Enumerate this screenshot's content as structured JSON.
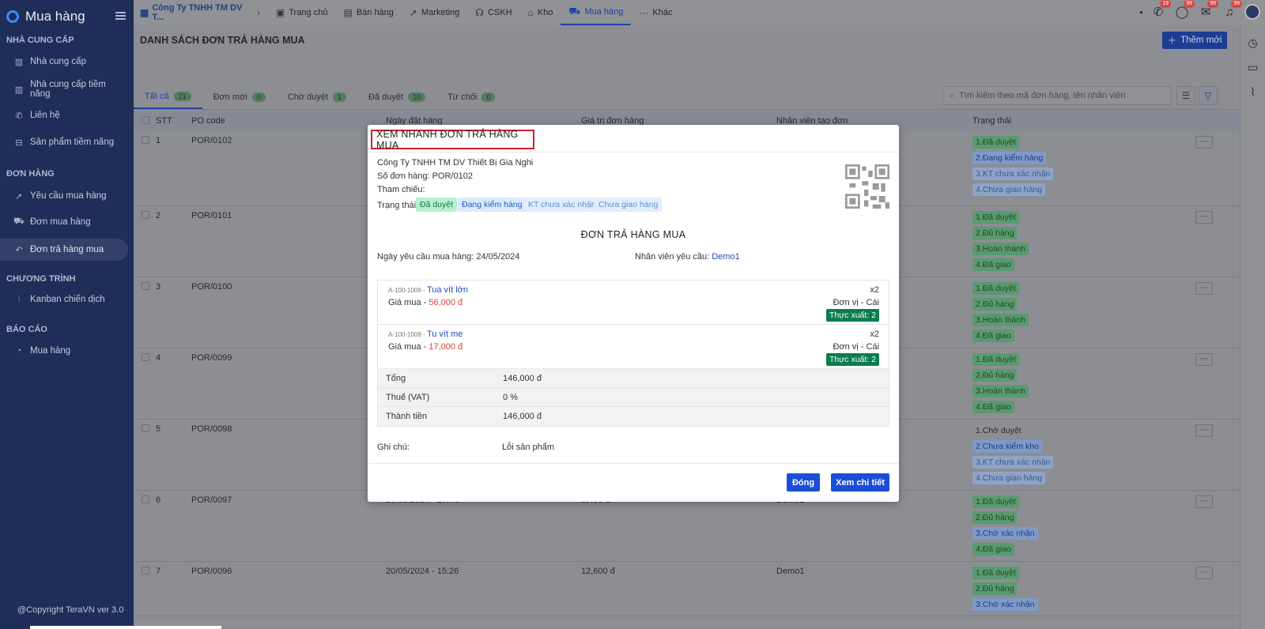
{
  "app": {
    "name": "Mua hàng",
    "copyright": "@Copyright TeraVN ver 3.0"
  },
  "sidebar": {
    "sections": [
      {
        "title": "NHÀ CUNG CẤP",
        "items": [
          {
            "label": "Nhà cung cấp",
            "icon": "building-icon"
          },
          {
            "label": "Nhà cung cấp tiềm năng",
            "icon": "building-icon"
          },
          {
            "label": "Liên hệ",
            "icon": "phone-icon"
          },
          {
            "label": "Sản phẩm tiềm năng",
            "icon": "box-icon"
          }
        ]
      },
      {
        "title": "ĐƠN HÀNG",
        "items": [
          {
            "label": "Yêu cầu mua hàng",
            "icon": "rocket-icon"
          },
          {
            "label": "Đơn mua hàng",
            "icon": "cart-icon"
          },
          {
            "label": "Đơn trả hàng mua",
            "icon": "return-icon",
            "active": true
          }
        ]
      },
      {
        "title": "CHƯƠNG TRÌNH",
        "items": [
          {
            "label": "Kanban chiến dịch",
            "icon": "kanban-icon"
          }
        ]
      },
      {
        "title": "BÁO CÁO",
        "items": [
          {
            "label": "Mua hàng",
            "icon": "pie-chart-icon"
          }
        ]
      }
    ]
  },
  "topbar": {
    "company": "Công Ty TNHH TM DV T...",
    "nav": [
      {
        "label": "Trang chủ",
        "icon": "home-icon"
      },
      {
        "label": "Bán hàng",
        "icon": "box-icon"
      },
      {
        "label": "Marketing",
        "icon": "rocket-icon"
      },
      {
        "label": "CSKH",
        "icon": "headset-icon"
      },
      {
        "label": "Kho",
        "icon": "warehouse-icon"
      },
      {
        "label": "Mua hàng",
        "icon": "cart-icon",
        "active": true
      },
      {
        "label": "Khác",
        "icon": "more-icon"
      }
    ],
    "badges": {
      "phone": "19",
      "chat": "99",
      "mail": "99",
      "bell": "99"
    }
  },
  "main": {
    "title": "DANH SÁCH ĐƠN TRẢ HÀNG MUA",
    "add_button": "Thêm mới",
    "search_placeholder": "Tìm kiếm theo mã đơn hàng, tên nhân viên",
    "tabs": [
      {
        "label": "Tất cả",
        "count": "21"
      },
      {
        "label": "Đơn mới",
        "count": "0"
      },
      {
        "label": "Chờ duyệt",
        "count": "1"
      },
      {
        "label": "Đã duyệt",
        "count": "10"
      },
      {
        "label": "Từ chối",
        "count": "0"
      }
    ],
    "columns": [
      "STT",
      "PO code",
      "Ngày đặt hàng",
      "Giá trị đơn hàng",
      "Nhân viên tạo đơn",
      "Trạng thái"
    ],
    "rows": [
      {
        "stt": "1",
        "code": "POR/0102",
        "date": "",
        "value": "",
        "staff": "",
        "status": [
          "1.Đã duyệt",
          "2.Đang kiểm hàng",
          "3.KT chưa xác nhận",
          "4.Chưa giao hàng"
        ]
      },
      {
        "stt": "2",
        "code": "POR/0101",
        "date": "",
        "value": "",
        "staff": "",
        "status": [
          "1.Đã duyệt",
          "2.Đủ hàng",
          "3.Hoàn thành",
          "4.Đã giao"
        ]
      },
      {
        "stt": "3",
        "code": "POR/0100",
        "date": "",
        "value": "",
        "staff": "",
        "status": [
          "1.Đã duyệt",
          "2.Đủ hàng",
          "3.Hoàn thành",
          "4.Đã giao"
        ]
      },
      {
        "stt": "4",
        "code": "POR/0099",
        "date": "",
        "value": "",
        "staff": "",
        "status": [
          "1.Đã duyệt",
          "2.Đủ hàng",
          "3.Hoàn thành",
          "4.Đã giao"
        ]
      },
      {
        "stt": "5",
        "code": "POR/0098",
        "date": "",
        "value": "",
        "staff": "",
        "status": [
          "1.Chờ duyệt",
          "2.Chưa kiểm kho",
          "3.KT chưa xác nhận",
          "4.Chưa giao hàng"
        ]
      },
      {
        "stt": "6",
        "code": "POR/0097",
        "date": "20/05/2024 - 17:40",
        "value": "8,400 đ",
        "staff": "Demo1",
        "status": [
          "1.Đã duyệt",
          "2.Đủ hàng",
          "3.Chờ xác nhận",
          "4.Đã giao"
        ]
      },
      {
        "stt": "7",
        "code": "POR/0096",
        "date": "20/05/2024 - 15:26",
        "value": "12,600 đ",
        "staff": "Demo1",
        "status": [
          "1.Đã duyệt",
          "2.Đủ hàng",
          "3.Chờ xác nhận"
        ]
      }
    ]
  },
  "modal": {
    "title": "XEM NHANH ĐƠN TRẢ HÀNG MUA",
    "company": "Công Ty TNHH TM DV Thiết Bị Gia Nghi",
    "order_no": "Số đơn hàng: POR/0102",
    "reference": "Tham chiếu:",
    "status_label": "Trạng thái:",
    "tags": [
      "Đã duyệt",
      "Đang kiểm hàng",
      "KT chưa xác nhận",
      "Chưa giao hàng"
    ],
    "heading": "ĐƠN TRẢ HÀNG MUA",
    "request_date": "Ngày yêu cầu mua hàng: 24/05/2024",
    "requester_label": "Nhân viên yêu cầu:",
    "requester": "Demo1",
    "items": [
      {
        "code": "A-100-1008 -",
        "name": "Tua vít lớn",
        "price_label": "Giá mua -",
        "price": "56,000 đ",
        "qty": "x2",
        "unit": "Đơn vị - Cái",
        "export": "Thực xuất: 2"
      },
      {
        "code": "A-100-1009 -",
        "name": "Tu vít me",
        "price_label": "Giá mua -",
        "price": "17,000 đ",
        "qty": "x2",
        "unit": "Đơn vị - Cái",
        "export": "Thực xuất: 2"
      }
    ],
    "summary": [
      {
        "k": "Tổng",
        "v": "146,000 đ"
      },
      {
        "k": "Thuế (VAT)",
        "v": "0 %"
      },
      {
        "k": "Thành tiền",
        "v": "146,000 đ"
      }
    ],
    "note_label": "Ghi chú:",
    "note": "Lỗi sản phẩm",
    "close_button": "Đóng",
    "detail_button": "Xem chi tiết"
  }
}
